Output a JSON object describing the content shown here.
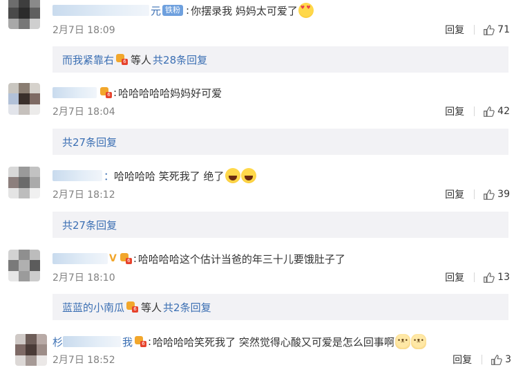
{
  "comments": [
    {
      "name_tail": "元",
      "badge": "铁粉",
      "text": "你摆录我  妈妈太可爱了",
      "emoji": [
        "love-eyes-emoji"
      ],
      "time": "2月7日 18:09",
      "reply_label": "回复",
      "likes": "71",
      "replies": {
        "user": "而我紧靠右",
        "suffix": "等人",
        "count_text": "共28条回复"
      }
    },
    {
      "name_tail": "",
      "text": "哈哈哈哈哈妈妈好可爱",
      "time": "2月7日 18:04",
      "reply_label": "回复",
      "likes": "42",
      "replies": {
        "count_text": "共27条回复"
      }
    },
    {
      "name_tail": "：",
      "text": "哈哈哈哈 笑死我了 绝了",
      "emoji": [
        "laughing-emoji",
        "laughing-emoji"
      ],
      "time": "2月7日 18:12",
      "reply_label": "回复",
      "likes": "39",
      "replies": {
        "count_text": "共27条回复"
      }
    },
    {
      "name_tail": "V",
      "text": "哈哈哈哈这个估计当爸的年三十儿要饿肚子了",
      "time": "2月7日 18:10",
      "reply_label": "回复",
      "likes": "13",
      "replies": {
        "user": "蓝蓝的小南瓜",
        "suffix": "等人",
        "count_text": "共2条回复"
      }
    },
    {
      "name_head": "杉",
      "name_tail": "我",
      "text": "哈哈哈哈笑死我了 突然觉得心酸又可爱是怎么回事啊",
      "emoji": [
        "cat-emoji",
        "cat-emoji"
      ],
      "time": "2月7日 18:52",
      "reply_label": "回复",
      "likes": "3"
    }
  ],
  "colors": {
    "link_blue": "#3b6fb3",
    "reply_bg": "#f2f2f5",
    "meta_grey": "#808080"
  }
}
